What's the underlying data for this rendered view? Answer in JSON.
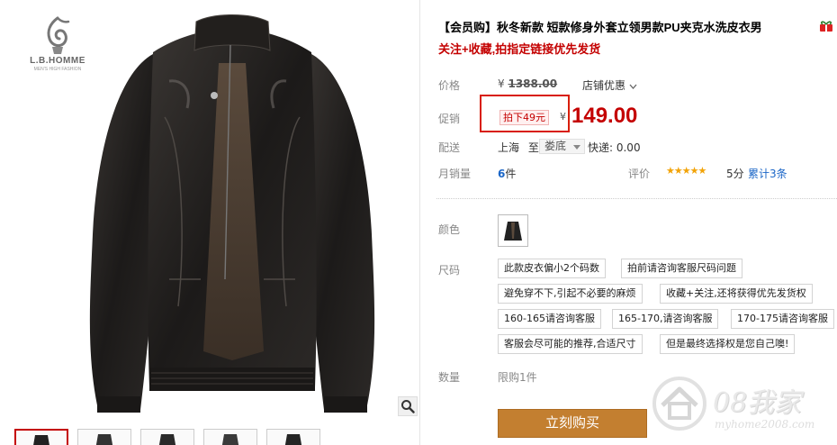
{
  "brand": {
    "name": "L.B.HOMME",
    "tagline": "MEN'S HIGH FASHION",
    "icon": "brand-logo"
  },
  "gallery": {
    "main_image": "black-leather-jacket",
    "zoom_icon": "magnifier-icon",
    "thumbnail_count": 5,
    "active_thumbnail": 0
  },
  "product": {
    "title": "【会员购】秋冬新款 短款修身外套立领男款PU夹克水洗皮衣男",
    "subtitle": "关注+收藏,拍指定链接优先发货",
    "title_icon": "gift-icon"
  },
  "price": {
    "label": "价格",
    "original": "1388.00",
    "currency": "¥",
    "shop_discount": "店铺优惠",
    "promo_label": "促销",
    "promo_tag": "拍下49元",
    "promo_price": "149.00"
  },
  "shipping": {
    "label": "配送",
    "from": "上海",
    "to_word": "至",
    "destination": "娄底",
    "fee": "快递: 0.00"
  },
  "sales": {
    "label": "月销量",
    "count": "6",
    "unit": "件",
    "rating_label": "评价",
    "stars": "★★★★★",
    "rating": 5,
    "score": "5分",
    "total": "累计3条"
  },
  "options": {
    "color_label": "颜色",
    "size_label": "尺码",
    "sizes": [
      "此款皮衣偏小2个码数",
      "拍前请咨询客服尺码问题",
      "避免穿不下,引起不必要的麻烦",
      "收藏+关注,还将获得优先发货权",
      "160-165请咨询客服",
      "165-170,请咨询客服",
      "170-175请咨询客服",
      "客服会尽可能的推荐,合适尺寸",
      "但是最终选择权是您自己噢!"
    ]
  },
  "quantity": {
    "label": "数量",
    "limit": "限购1件"
  },
  "actions": {
    "buy_now": "立刻购买"
  },
  "watermark": {
    "main": "08我家",
    "url": "myhome2008.com"
  },
  "colors": {
    "accent_red": "#c40000",
    "highlight_box": "#d81e06",
    "buy_button": "#c37f30",
    "link_blue": "#1b66c7",
    "star_gold": "#f2a308"
  }
}
